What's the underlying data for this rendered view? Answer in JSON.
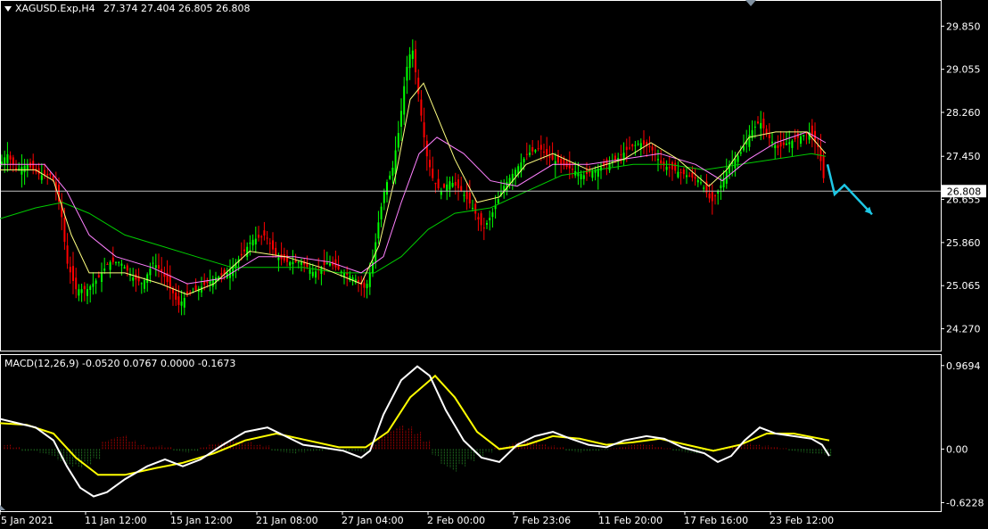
{
  "header": {
    "symbol": "XAGUSD.Exp,H4",
    "ohlc": "27.374 27.404 26.805 26.808"
  },
  "macd_header": {
    "label": "MACD(12,26,9)",
    "values": "-0.0520 0.0767 0.0000 -0.1673"
  },
  "colors": {
    "background": "#000000",
    "bull_candle": "#00ff00",
    "bear_candle": "#ff0000",
    "ma_fast": "#ffff80",
    "ma_mid": "#ff80ff",
    "ma_slow": "#00cc00",
    "arrow": "#1ec8e6",
    "macd_line": "#ffffff",
    "signal_line": "#ffff00",
    "hist_pos": "#a00000",
    "hist_neg": "#1f6e1f",
    "grid_border": "#ffffff"
  },
  "chart_data": [
    {
      "type": "candlestick",
      "title": "XAGUSD.Exp,H4",
      "ylim": [
        23.95,
        30.25
      ],
      "y_ticks": [
        "29.850",
        "29.055",
        "28.260",
        "27.450",
        "26.655",
        "25.860",
        "25.065",
        "24.270"
      ],
      "current_price": "26.808",
      "x_ticks": [
        "5 Jan 2021",
        "11 Jan 12:00",
        "15 Jan 12:00",
        "21 Jan 08:00",
        "27 Jan 04:00",
        "2 Feb 00:00",
        "7 Feb 23:06",
        "11 Feb 20:00",
        "17 Feb 16:00",
        "23 Feb 12:00"
      ],
      "price_path": [
        [
          0,
          27.3
        ],
        [
          8,
          27.5
        ],
        [
          18,
          27.2
        ],
        [
          30,
          27.3
        ],
        [
          45,
          27.1
        ],
        [
          58,
          27.1
        ],
        [
          68,
          26.5
        ],
        [
          75,
          25.5
        ],
        [
          85,
          25.0
        ],
        [
          98,
          25.0
        ],
        [
          110,
          25.2
        ],
        [
          122,
          25.5
        ],
        [
          135,
          25.5
        ],
        [
          150,
          25.2
        ],
        [
          160,
          25.1
        ],
        [
          172,
          25.5
        ],
        [
          182,
          25.3
        ],
        [
          192,
          25.0
        ],
        [
          200,
          24.7
        ],
        [
          210,
          24.9
        ],
        [
          222,
          25.0
        ],
        [
          240,
          25.2
        ],
        [
          255,
          25.3
        ],
        [
          270,
          25.6
        ],
        [
          282,
          25.9
        ],
        [
          298,
          26.0
        ],
        [
          310,
          25.6
        ],
        [
          322,
          25.5
        ],
        [
          338,
          25.5
        ],
        [
          352,
          25.3
        ],
        [
          368,
          25.5
        ],
        [
          385,
          25.3
        ],
        [
          398,
          25.2
        ],
        [
          410,
          25.0
        ],
        [
          418,
          25.5
        ],
        [
          425,
          26.3
        ],
        [
          432,
          26.9
        ],
        [
          440,
          27.2
        ],
        [
          448,
          28.0
        ],
        [
          455,
          29.0
        ],
        [
          462,
          29.5
        ],
        [
          470,
          28.5
        ],
        [
          478,
          27.5
        ],
        [
          486,
          27.0
        ],
        [
          494,
          26.8
        ],
        [
          505,
          27.0
        ],
        [
          518,
          26.8
        ],
        [
          530,
          26.5
        ],
        [
          542,
          26.1
        ],
        [
          552,
          26.4
        ],
        [
          565,
          26.9
        ],
        [
          578,
          27.2
        ],
        [
          592,
          27.5
        ],
        [
          605,
          27.6
        ],
        [
          618,
          27.4
        ],
        [
          630,
          27.3
        ],
        [
          642,
          27.2
        ],
        [
          655,
          27.1
        ],
        [
          668,
          27.2
        ],
        [
          680,
          27.3
        ],
        [
          692,
          27.4
        ],
        [
          705,
          27.6
        ],
        [
          718,
          27.7
        ],
        [
          730,
          27.6
        ],
        [
          742,
          27.3
        ],
        [
          755,
          27.2
        ],
        [
          770,
          27.1
        ],
        [
          785,
          27.0
        ],
        [
          798,
          26.6
        ],
        [
          808,
          26.9
        ],
        [
          818,
          27.3
        ],
        [
          830,
          27.5
        ],
        [
          842,
          27.9
        ],
        [
          852,
          28.1
        ],
        [
          862,
          27.8
        ],
        [
          872,
          27.6
        ],
        [
          884,
          27.7
        ],
        [
          896,
          27.8
        ],
        [
          908,
          27.9
        ],
        [
          918,
          27.6
        ],
        [
          926,
          26.81
        ]
      ],
      "forecast_path": [
        [
          928,
          27.3
        ],
        [
          936,
          26.75
        ],
        [
          947,
          26.92
        ],
        [
          978,
          26.38
        ]
      ],
      "ma_fast_path": [
        [
          0,
          27.2
        ],
        [
          40,
          27.2
        ],
        [
          60,
          27.0
        ],
        [
          80,
          26.0
        ],
        [
          100,
          25.3
        ],
        [
          140,
          25.3
        ],
        [
          180,
          25.1
        ],
        [
          210,
          24.9
        ],
        [
          240,
          25.1
        ],
        [
          280,
          25.7
        ],
        [
          320,
          25.6
        ],
        [
          360,
          25.4
        ],
        [
          405,
          25.1
        ],
        [
          425,
          25.8
        ],
        [
          445,
          27.2
        ],
        [
          460,
          28.5
        ],
        [
          475,
          28.8
        ],
        [
          490,
          28.2
        ],
        [
          510,
          27.4
        ],
        [
          535,
          26.6
        ],
        [
          560,
          26.7
        ],
        [
          590,
          27.3
        ],
        [
          620,
          27.5
        ],
        [
          660,
          27.2
        ],
        [
          700,
          27.4
        ],
        [
          730,
          27.7
        ],
        [
          760,
          27.4
        ],
        [
          795,
          26.9
        ],
        [
          815,
          27.2
        ],
        [
          840,
          27.8
        ],
        [
          870,
          27.9
        ],
        [
          905,
          27.9
        ],
        [
          926,
          27.5
        ]
      ],
      "ma_mid_path": [
        [
          0,
          27.3
        ],
        [
          50,
          27.3
        ],
        [
          75,
          26.8
        ],
        [
          100,
          26.0
        ],
        [
          130,
          25.6
        ],
        [
          170,
          25.4
        ],
        [
          210,
          25.1
        ],
        [
          250,
          25.2
        ],
        [
          290,
          25.6
        ],
        [
          330,
          25.6
        ],
        [
          370,
          25.5
        ],
        [
          405,
          25.3
        ],
        [
          430,
          25.6
        ],
        [
          450,
          26.6
        ],
        [
          470,
          27.5
        ],
        [
          490,
          27.8
        ],
        [
          520,
          27.5
        ],
        [
          550,
          27.0
        ],
        [
          580,
          26.9
        ],
        [
          620,
          27.3
        ],
        [
          660,
          27.3
        ],
        [
          700,
          27.4
        ],
        [
          740,
          27.5
        ],
        [
          780,
          27.3
        ],
        [
          810,
          27.0
        ],
        [
          840,
          27.4
        ],
        [
          870,
          27.7
        ],
        [
          905,
          27.9
        ],
        [
          926,
          27.7
        ]
      ],
      "ma_slow_path": [
        [
          0,
          26.3
        ],
        [
          40,
          26.5
        ],
        [
          70,
          26.6
        ],
        [
          100,
          26.4
        ],
        [
          140,
          26.0
        ],
        [
          180,
          25.8
        ],
        [
          220,
          25.6
        ],
        [
          260,
          25.4
        ],
        [
          300,
          25.4
        ],
        [
          340,
          25.4
        ],
        [
          380,
          25.3
        ],
        [
          420,
          25.3
        ],
        [
          450,
          25.6
        ],
        [
          480,
          26.1
        ],
        [
          510,
          26.4
        ],
        [
          550,
          26.5
        ],
        [
          590,
          26.8
        ],
        [
          630,
          27.1
        ],
        [
          670,
          27.2
        ],
        [
          710,
          27.3
        ],
        [
          750,
          27.3
        ],
        [
          790,
          27.2
        ],
        [
          830,
          27.3
        ],
        [
          870,
          27.4
        ],
        [
          910,
          27.5
        ],
        [
          926,
          27.45
        ]
      ]
    },
    {
      "type": "line",
      "title": "MACD(12,26,9)",
      "ylim": [
        -0.69,
        1.05
      ],
      "y_ticks": [
        "0.9694",
        "0.00",
        "-0.6228"
      ],
      "macd_path": [
        [
          0,
          0.35
        ],
        [
          20,
          0.3
        ],
        [
          40,
          0.25
        ],
        [
          60,
          0.1
        ],
        [
          75,
          -0.2
        ],
        [
          90,
          -0.45
        ],
        [
          105,
          -0.55
        ],
        [
          120,
          -0.5
        ],
        [
          140,
          -0.35
        ],
        [
          165,
          -0.2
        ],
        [
          185,
          -0.12
        ],
        [
          205,
          -0.2
        ],
        [
          225,
          -0.12
        ],
        [
          250,
          0.05
        ],
        [
          275,
          0.2
        ],
        [
          300,
          0.25
        ],
        [
          320,
          0.15
        ],
        [
          340,
          0.05
        ],
        [
          360,
          0.02
        ],
        [
          385,
          -0.02
        ],
        [
          405,
          -0.1
        ],
        [
          415,
          -0.02
        ],
        [
          430,
          0.4
        ],
        [
          450,
          0.8
        ],
        [
          468,
          0.96
        ],
        [
          482,
          0.85
        ],
        [
          500,
          0.45
        ],
        [
          520,
          0.1
        ],
        [
          540,
          -0.1
        ],
        [
          560,
          -0.15
        ],
        [
          580,
          0.05
        ],
        [
          600,
          0.15
        ],
        [
          620,
          0.2
        ],
        [
          640,
          0.12
        ],
        [
          660,
          0.05
        ],
        [
          680,
          0.02
        ],
        [
          700,
          0.1
        ],
        [
          725,
          0.15
        ],
        [
          745,
          0.12
        ],
        [
          765,
          0.02
        ],
        [
          790,
          -0.05
        ],
        [
          805,
          -0.15
        ],
        [
          820,
          -0.08
        ],
        [
          835,
          0.1
        ],
        [
          852,
          0.25
        ],
        [
          870,
          0.18
        ],
        [
          890,
          0.15
        ],
        [
          910,
          0.12
        ],
        [
          922,
          0.05
        ],
        [
          930,
          -0.08
        ]
      ],
      "signal_path": [
        [
          0,
          0.3
        ],
        [
          30,
          0.28
        ],
        [
          60,
          0.18
        ],
        [
          85,
          -0.1
        ],
        [
          110,
          -0.3
        ],
        [
          140,
          -0.3
        ],
        [
          175,
          -0.22
        ],
        [
          205,
          -0.16
        ],
        [
          240,
          -0.05
        ],
        [
          275,
          0.1
        ],
        [
          310,
          0.18
        ],
        [
          345,
          0.1
        ],
        [
          380,
          0.02
        ],
        [
          410,
          0.02
        ],
        [
          435,
          0.2
        ],
        [
          460,
          0.6
        ],
        [
          488,
          0.85
        ],
        [
          510,
          0.6
        ],
        [
          535,
          0.2
        ],
        [
          560,
          0.0
        ],
        [
          590,
          0.05
        ],
        [
          620,
          0.15
        ],
        [
          650,
          0.12
        ],
        [
          680,
          0.05
        ],
        [
          710,
          0.08
        ],
        [
          740,
          0.12
        ],
        [
          770,
          0.05
        ],
        [
          800,
          -0.02
        ],
        [
          830,
          0.05
        ],
        [
          860,
          0.18
        ],
        [
          890,
          0.18
        ],
        [
          930,
          0.1
        ]
      ],
      "histogram": [
        [
          5,
          0.05
        ],
        [
          15,
          0.02
        ],
        [
          25,
          -0.03
        ],
        [
          35,
          -0.02
        ],
        [
          45,
          -0.05
        ],
        [
          55,
          -0.08
        ],
        [
          65,
          -0.15
        ],
        [
          75,
          -0.2
        ],
        [
          85,
          -0.22
        ],
        [
          95,
          -0.18
        ],
        [
          105,
          -0.12
        ],
        [
          115,
          0.1
        ],
        [
          125,
          0.14
        ],
        [
          135,
          0.16
        ],
        [
          145,
          0.1
        ],
        [
          155,
          0.05
        ],
        [
          165,
          0.03
        ],
        [
          175,
          0.04
        ],
        [
          185,
          0.02
        ],
        [
          195,
          -0.02
        ],
        [
          205,
          -0.04
        ],
        [
          215,
          -0.02
        ],
        [
          225,
          0.02
        ],
        [
          235,
          0.06
        ],
        [
          245,
          0.08
        ],
        [
          255,
          0.1
        ],
        [
          265,
          0.1
        ],
        [
          275,
          0.08
        ],
        [
          285,
          0.05
        ],
        [
          295,
          0.04
        ],
        [
          305,
          -0.02
        ],
        [
          315,
          -0.04
        ],
        [
          325,
          -0.05
        ],
        [
          335,
          -0.04
        ],
        [
          345,
          -0.03
        ],
        [
          355,
          -0.02
        ],
        [
          365,
          -0.01
        ],
        [
          375,
          -0.01
        ],
        [
          385,
          -0.02
        ],
        [
          395,
          -0.03
        ],
        [
          405,
          -0.04
        ],
        [
          415,
          0.05
        ],
        [
          425,
          0.15
        ],
        [
          435,
          0.22
        ],
        [
          445,
          0.28
        ],
        [
          455,
          0.26
        ],
        [
          465,
          0.2
        ],
        [
          475,
          0.1
        ],
        [
          485,
          -0.08
        ],
        [
          495,
          -0.2
        ],
        [
          505,
          -0.26
        ],
        [
          515,
          -0.2
        ],
        [
          525,
          -0.14
        ],
        [
          535,
          -0.08
        ],
        [
          545,
          -0.04
        ],
        [
          555,
          0.02
        ],
        [
          565,
          0.04
        ],
        [
          575,
          0.08
        ],
        [
          585,
          0.09
        ],
        [
          595,
          0.08
        ],
        [
          605,
          0.06
        ],
        [
          615,
          0.04
        ],
        [
          625,
          0.02
        ],
        [
          635,
          -0.02
        ],
        [
          645,
          -0.04
        ],
        [
          655,
          -0.03
        ],
        [
          665,
          -0.02
        ],
        [
          675,
          -0.01
        ],
        [
          685,
          0.01
        ],
        [
          695,
          0.03
        ],
        [
          705,
          0.05
        ],
        [
          715,
          0.06
        ],
        [
          725,
          0.05
        ],
        [
          735,
          0.03
        ],
        [
          745,
          0.01
        ],
        [
          755,
          -0.02
        ],
        [
          765,
          -0.04
        ],
        [
          775,
          -0.05
        ],
        [
          785,
          -0.03
        ],
        [
          795,
          -0.02
        ],
        [
          805,
          -0.01
        ],
        [
          815,
          0.03
        ],
        [
          825,
          0.06
        ],
        [
          835,
          0.07
        ],
        [
          845,
          0.05
        ],
        [
          855,
          0.04
        ],
        [
          865,
          0.03
        ],
        [
          875,
          0.01
        ],
        [
          885,
          -0.02
        ],
        [
          895,
          -0.04
        ],
        [
          905,
          -0.05
        ],
        [
          915,
          -0.06
        ],
        [
          925,
          -0.08
        ]
      ]
    }
  ]
}
